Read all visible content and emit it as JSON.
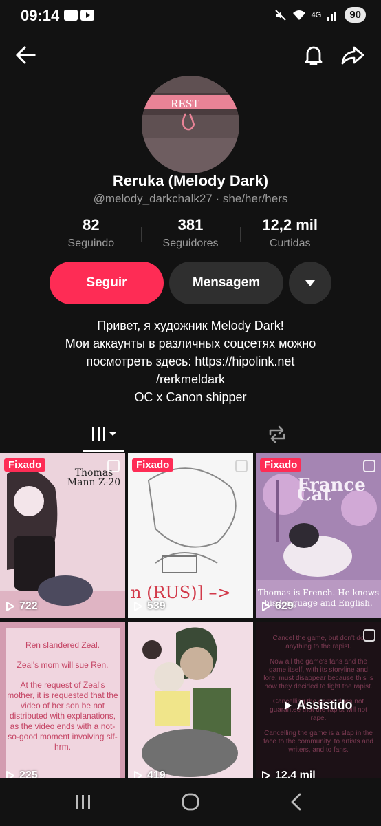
{
  "status_bar": {
    "time": "09:14",
    "battery": "90",
    "network": "4G"
  },
  "header": {
    "back_icon": "arrow-left-icon",
    "bell_icon": "bell-icon",
    "share_icon": "share-arrow-icon"
  },
  "profile": {
    "avatar_text": "REST",
    "name": "Reruka (Melody Dark)",
    "handle": "@melody_darkchalk27 · she/her/hers",
    "stats": [
      {
        "value": "82",
        "label": "Seguindo"
      },
      {
        "value": "381",
        "label": "Seguidores"
      },
      {
        "value": "12,2 mil",
        "label": "Curtidas"
      }
    ],
    "actions": {
      "follow": "Seguir",
      "message": "Mensagem"
    },
    "bio": [
      "Привет, я художник Melody Dark!",
      "Мои аккаунты в различных соцсетях можно",
      "посмотреть здесь: https://hipolink.net",
      "/rerkmeldark",
      "OC x Canon shipper"
    ]
  },
  "tabs": [
    {
      "icon": "grid-videos-icon",
      "selected": true
    },
    {
      "icon": "repost-icon",
      "selected": false
    }
  ],
  "videos": [
    {
      "pinned": "Fixado",
      "views": "722",
      "caption": "Thomas Mann Z-20"
    },
    {
      "pinned": "Fixado",
      "views": "539",
      "caption": "n (RUS)] –>"
    },
    {
      "pinned": "Fixado",
      "views": "629",
      "caption": "Thomas is French. He knows his language and English.",
      "title_art": "France Cat"
    },
    {
      "views": "225",
      "caption": [
        "Ren slandered Zeal.",
        "Zeal's mom will sue Ren.",
        "At the request of Zeal's mother, it is requested that the video of her son be not distributed with explanations, as the video ends with a not-so-good moment involving slf-hrm."
      ]
    },
    {
      "views": "419"
    },
    {
      "watched": "Assistido",
      "views": "12,4 mil",
      "caption": [
        "Cancel the game, but don't do anything to the rapist.",
        "Now all the game's fans and the game itself, with its storyline and lore, must disappear because this is how they decided to fight the rapist.",
        "Cancelling the game does not guarantee that the rapist will not rape.",
        "Cancelling the game is a slap in the face to the community, to artists and writers, and to fans."
      ]
    }
  ],
  "colors": {
    "accent": "#fe2c55",
    "background": "#121212",
    "secondary_button": "#2f2f2f"
  }
}
